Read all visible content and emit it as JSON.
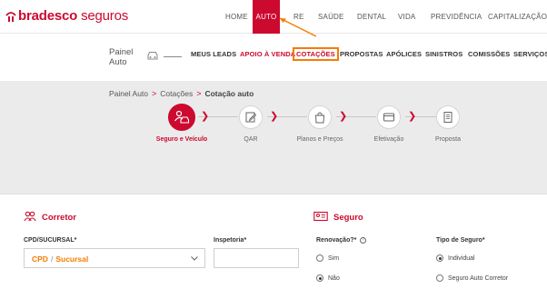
{
  "brand": {
    "name_bold": "bradesco",
    "name_light": " seguros",
    "color": "#cc092f"
  },
  "accent": "#f57c00",
  "topnav": {
    "items": [
      {
        "label": "HOME",
        "active": false
      },
      {
        "label": "AUTO",
        "active": true
      },
      {
        "label": "RE",
        "active": false
      },
      {
        "label": "SAÚDE",
        "active": false
      },
      {
        "label": "DENTAL",
        "active": false
      },
      {
        "label": "VIDA",
        "active": false
      },
      {
        "label": "PREVIDÊNCIA",
        "active": false
      },
      {
        "label": "CAPITALIZAÇÃO",
        "active": false
      }
    ]
  },
  "subnav": {
    "title": "Painel Auto",
    "icon": "car-icon",
    "items": [
      {
        "label": "MEUS LEADS",
        "style": "normal"
      },
      {
        "label": "APOIO À VENDA",
        "style": "red"
      },
      {
        "label": "COTAÇÕES",
        "style": "highlighted"
      },
      {
        "label": "PROPOSTAS",
        "style": "normal"
      },
      {
        "label": "APÓLICES",
        "style": "normal"
      },
      {
        "label": "SINISTROS",
        "style": "normal"
      },
      {
        "label": "COMISSÕES",
        "style": "normal"
      },
      {
        "label": "SERVIÇOS",
        "style": "normal"
      }
    ]
  },
  "breadcrumb": {
    "items": [
      "Painel Auto",
      "Cotações",
      "Cotação auto"
    ],
    "separator": ">"
  },
  "stepper": {
    "steps": [
      {
        "label": "Seguro e Veículo",
        "icon": "car-person-icon",
        "active": true
      },
      {
        "label": "QAR",
        "icon": "edit-icon",
        "active": false
      },
      {
        "label": "Planos e Preços",
        "icon": "shopping-bag-icon",
        "active": false
      },
      {
        "label": "Efetivação",
        "icon": "credit-card-icon",
        "active": false
      },
      {
        "label": "Proposta",
        "icon": "document-icon",
        "active": false
      }
    ]
  },
  "corretor": {
    "title": "Corretor",
    "icon": "people-icon",
    "cpd_label": "CPD/SUCURSAL*",
    "cpd_value": "CPD",
    "cpd_separator": "/",
    "sucursal_value": "Sucursal",
    "inspetoria_label": "Inspetoria*",
    "inspetoria_value": ""
  },
  "seguro": {
    "title": "Seguro",
    "icon": "id-card-icon",
    "renovacao_label": "Renovação?*",
    "renovacao_options": [
      {
        "label": "Sim",
        "checked": false
      },
      {
        "label": "Não",
        "checked": true
      }
    ],
    "tipo_label": "Tipo de Seguro*",
    "tipo_options": [
      {
        "label": "Individual",
        "checked": true
      },
      {
        "label": "Seguro Auto Corretor",
        "checked": false
      }
    ]
  }
}
